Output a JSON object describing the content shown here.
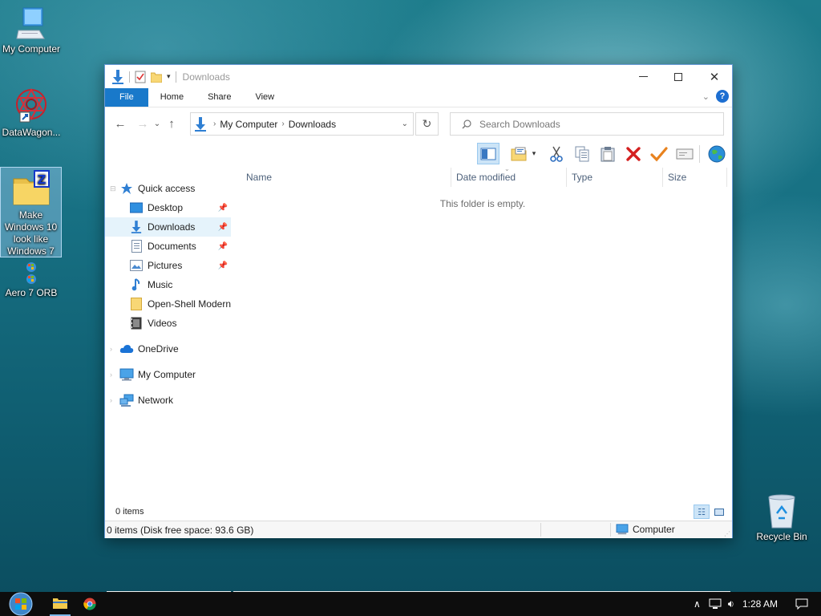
{
  "desktop": {
    "icons": [
      {
        "label": "My Computer"
      },
      {
        "label": "DataWagon..."
      },
      {
        "label": "Make Windows 10 look like Windows 7"
      },
      {
        "label": "Aero 7 ORB"
      },
      {
        "label": "Recycle Bin"
      }
    ]
  },
  "window": {
    "title": "Downloads",
    "ribbon_tabs": [
      "File",
      "Home",
      "Share",
      "View"
    ],
    "help_label": "?",
    "address": {
      "root": "My Computer",
      "current": "Downloads"
    },
    "search": {
      "placeholder": "Search Downloads"
    },
    "nav": {
      "quick_access": "Quick access",
      "pinned": [
        {
          "label": "Desktop",
          "icon": "desktop-icon"
        },
        {
          "label": "Downloads",
          "icon": "downloads-icon"
        },
        {
          "label": "Documents",
          "icon": "documents-icon"
        },
        {
          "label": "Pictures",
          "icon": "pictures-icon"
        },
        {
          "label": "Music",
          "icon": "music-icon"
        },
        {
          "label": "Open-Shell Modern",
          "icon": "folder-icon"
        },
        {
          "label": "Videos",
          "icon": "videos-icon"
        }
      ],
      "onedrive": "OneDrive",
      "my_computer": "My Computer",
      "network": "Network"
    },
    "columns": [
      "Name",
      "Date modified",
      "Type",
      "Size"
    ],
    "empty_message": "This folder is empty.",
    "item_count": "0 items",
    "status_left": "0 items (Disk free space: 93.6 GB)",
    "status_right": "Computer"
  },
  "taskbar": {
    "clock": "1:28 AM"
  },
  "colors": {
    "accent": "#1979ca",
    "selection": "#cce4f7",
    "delete_red": "#d42020",
    "check_orange": "#e8821e"
  }
}
